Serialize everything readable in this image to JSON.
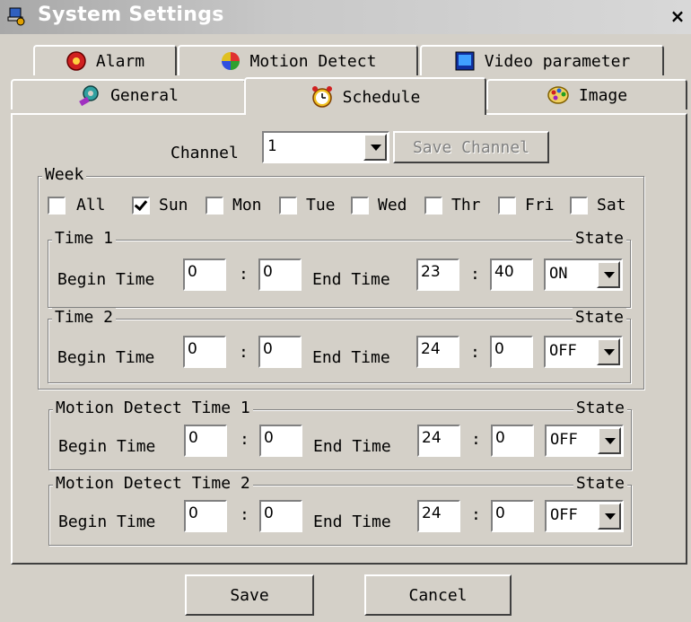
{
  "window": {
    "title": "System Settings",
    "close_glyph": "×"
  },
  "tabs_row1": [
    {
      "label": "Alarm",
      "icon": "alarm-icon"
    },
    {
      "label": "Motion Detect",
      "icon": "color-wheel-icon"
    },
    {
      "label": "Video parameter",
      "icon": "monitor-icon"
    }
  ],
  "tabs_row2": [
    {
      "label": "General",
      "icon": "gear-icon"
    },
    {
      "label": "Schedule",
      "icon": "alarm-clock-icon",
      "active": true
    },
    {
      "label": "Image",
      "icon": "palette-icon"
    }
  ],
  "channel": {
    "label": "Channel",
    "value": "1",
    "save_label": "Save Channel"
  },
  "week": {
    "legend": "Week",
    "days": [
      {
        "label": "All",
        "checked": false
      },
      {
        "label": "Sun",
        "checked": true
      },
      {
        "label": "Mon",
        "checked": false
      },
      {
        "label": "Tue",
        "checked": false
      },
      {
        "label": "Wed",
        "checked": false
      },
      {
        "label": "Thr",
        "checked": false
      },
      {
        "label": "Fri",
        "checked": false
      },
      {
        "label": "Sat",
        "checked": false
      }
    ]
  },
  "labels": {
    "begin": "Begin Time",
    "end": "End Time",
    "state": "State",
    "colon": ":"
  },
  "time1": {
    "legend": "Time 1",
    "begin_h": "0",
    "begin_m": "0",
    "end_h": "23",
    "end_m": "40",
    "state": "ON"
  },
  "time2": {
    "legend": "Time 2",
    "begin_h": "0",
    "begin_m": "0",
    "end_h": "24",
    "end_m": "0",
    "state": "OFF"
  },
  "md1": {
    "legend": "Motion Detect Time 1",
    "begin_h": "0",
    "begin_m": "0",
    "end_h": "24",
    "end_m": "0",
    "state": "OFF"
  },
  "md2": {
    "legend": "Motion Detect Time 2",
    "begin_h": "0",
    "begin_m": "0",
    "end_h": "24",
    "end_m": "0",
    "state": "OFF"
  },
  "footer": {
    "save_label": "Save",
    "cancel_label": "Cancel"
  }
}
